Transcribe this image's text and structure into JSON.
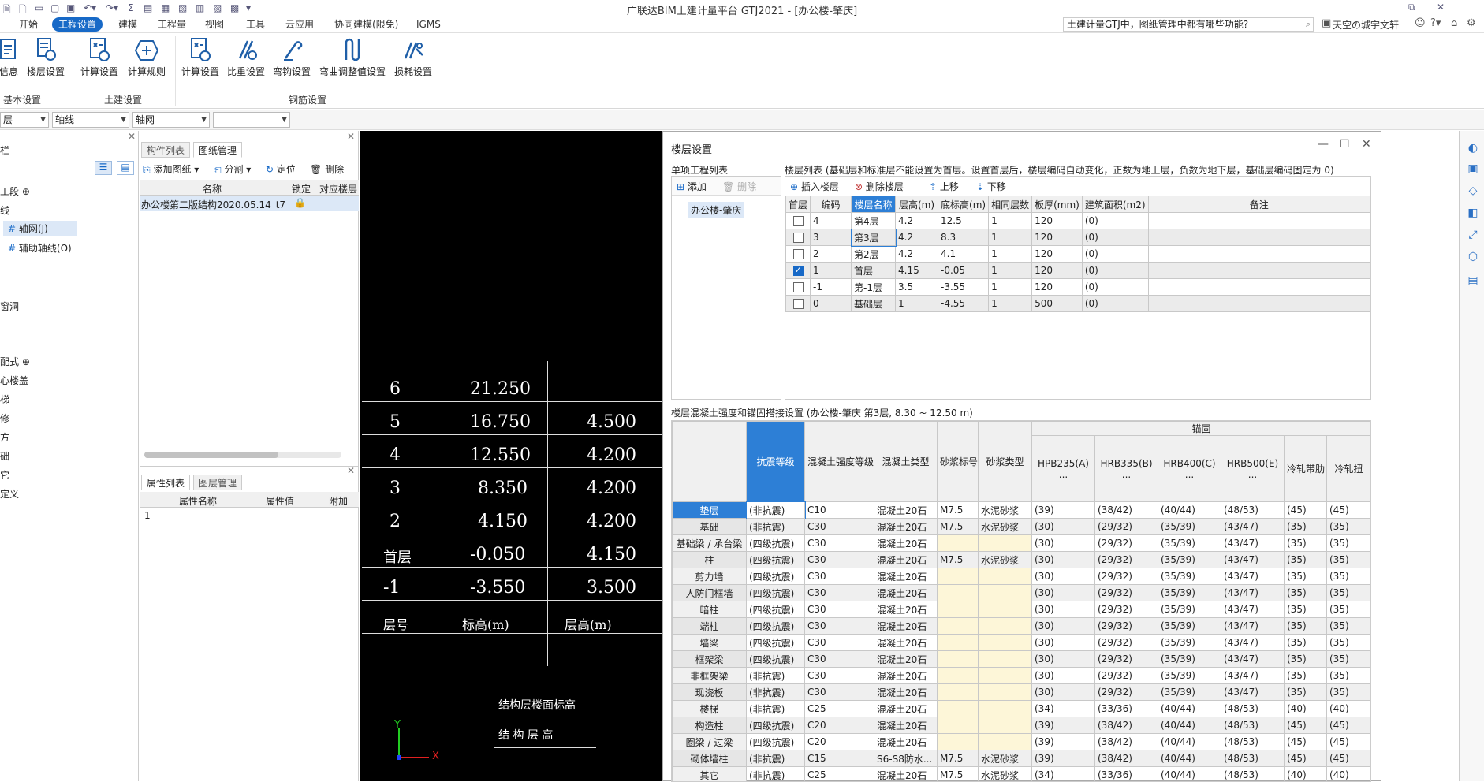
{
  "window": {
    "title": "广联达BIM土建计量平台 GTJ2021 - [办公楼-肇庆]"
  },
  "menu": {
    "items": [
      "开始",
      "工程设置",
      "建模",
      "工程量",
      "视图",
      "工具",
      "云应用",
      "协同建模(限免)",
      "IGMS"
    ],
    "active": "工程设置"
  },
  "search": {
    "value": "土建计量GTJ中，图纸管理中都有哪些功能?"
  },
  "user": {
    "name": "天空の城宇文轩"
  },
  "ribbon": {
    "groups": [
      {
        "label": "基本设置",
        "buttons": [
          "信息",
          "楼层设置"
        ]
      },
      {
        "label": "土建设置",
        "buttons": [
          "计算设置",
          "计算规则"
        ]
      },
      {
        "label": "钢筋设置",
        "buttons": [
          "计算设置",
          "比重设置",
          "弯钩设置",
          "弯曲调整值设置",
          "损耗设置"
        ]
      }
    ]
  },
  "toolbar2": {
    "combo1": "层",
    "combo2": "轴线",
    "combo3": "轴网",
    "combo4": ""
  },
  "left_panel": {
    "header": "栏",
    "items": [
      "工段 ⊕",
      "线",
      "轴网(J)",
      "辅助轴线(O)",
      "窗洞",
      "配式 ⊕",
      "心楼盖",
      "梯",
      "修",
      "方",
      "础",
      "它",
      "定义"
    ]
  },
  "mid_panel": {
    "tabs": [
      "构件列表",
      "图纸管理"
    ],
    "active_tab": "图纸管理",
    "actions": [
      "添加图纸",
      "分割",
      "定位",
      "删除"
    ],
    "columns": [
      "名称",
      "锁定",
      "对应楼层"
    ],
    "rows": [
      {
        "name": "办公楼第二版结构2020.05.14_t7",
        "lock": "🔒",
        "floor": ""
      }
    ],
    "prop_tabs": [
      "属性列表",
      "图层管理"
    ],
    "prop_columns": [
      "属性名称",
      "属性值",
      "附加"
    ],
    "prop_rows": [
      "1"
    ]
  },
  "cad": {
    "rows": [
      {
        "floor": "6",
        "elev": "21.250",
        "height": ""
      },
      {
        "floor": "5",
        "elev": "16.750",
        "height": "4.500"
      },
      {
        "floor": "4",
        "elev": "12.550",
        "height": "4.200"
      },
      {
        "floor": "3",
        "elev": "8.350",
        "height": "4.200"
      },
      {
        "floor": "2",
        "elev": "4.150",
        "height": "4.200"
      },
      {
        "floor": "首层",
        "elev": "-0.050",
        "height": "4.150"
      },
      {
        "floor": "-1",
        "elev": "-3.550",
        "height": "3.500"
      },
      {
        "floor": "层号",
        "elev": "标高(m)",
        "height": "层高(m)"
      }
    ],
    "caption1": "结构层楼面标高",
    "caption2": "结 构 层 高",
    "axis_y": "Y",
    "axis_x": "X"
  },
  "dialog": {
    "title": "楼层设置",
    "project_list_label": "单项工程列表",
    "floor_list_label": "楼层列表 (基础层和标准层不能设置为首层。设置首层后，楼层编码自动变化，正数为地上层，负数为地下层，基础层编码固定为 0)",
    "project_actions": [
      "添加",
      "删除"
    ],
    "project_item": "办公楼-肇庆",
    "floor_actions": [
      "插入楼层",
      "删除楼层",
      "上移",
      "下移"
    ],
    "floor_columns": [
      "首层",
      "编码",
      "楼层名称",
      "层高(m)",
      "底标高(m)",
      "相同层数",
      "板厚(mm)",
      "建筑面积(m2)",
      "备注"
    ],
    "floors": [
      {
        "first": false,
        "code": "4",
        "name": "第4层",
        "height": "4.2",
        "bottom": "12.5",
        "same": "1",
        "slab": "120",
        "area": "(0)",
        "note": ""
      },
      {
        "first": false,
        "code": "3",
        "name": "第3层",
        "height": "4.2",
        "bottom": "8.3",
        "same": "1",
        "slab": "120",
        "area": "(0)",
        "note": ""
      },
      {
        "first": false,
        "code": "2",
        "name": "第2层",
        "height": "4.2",
        "bottom": "4.1",
        "same": "1",
        "slab": "120",
        "area": "(0)",
        "note": ""
      },
      {
        "first": true,
        "code": "1",
        "name": "首层",
        "height": "4.15",
        "bottom": "-0.05",
        "same": "1",
        "slab": "120",
        "area": "(0)",
        "note": ""
      },
      {
        "first": false,
        "code": "-1",
        "name": "第-1层",
        "height": "3.5",
        "bottom": "-3.55",
        "same": "1",
        "slab": "120",
        "area": "(0)",
        "note": ""
      },
      {
        "first": false,
        "code": "0",
        "name": "基础层",
        "height": "1",
        "bottom": "-4.55",
        "same": "1",
        "slab": "500",
        "area": "(0)",
        "note": ""
      }
    ],
    "concrete_label": "楼层混凝土强度和锚固搭接设置 (办公楼-肇庆 第3层, 8.30 ~ 12.50 m)",
    "anchor_header": "锚固",
    "concrete_columns": [
      "抗震等级",
      "混凝土强度等级",
      "混凝土类型",
      "砂浆标号",
      "砂浆类型",
      "HPB235(A)\n...",
      "HRB335(B)\n...",
      "HRB400(C)\n...",
      "HRB500(E)\n...",
      "冷轧带肋",
      "冷轧扭"
    ],
    "concrete_rows": [
      {
        "name": "垫层",
        "seismic": "(非抗震)",
        "grade": "C10",
        "type": "混凝土20石",
        "mortar": "M7.5",
        "mtype": "水泥砂浆",
        "a": "(39)",
        "b": "(38/42)",
        "c": "(40/44)",
        "e": "(48/53)",
        "lz": "(45)",
        "lzn": "(45)"
      },
      {
        "name": "基础",
        "seismic": "(非抗震)",
        "grade": "C30",
        "type": "混凝土20石",
        "mortar": "M7.5",
        "mtype": "水泥砂浆",
        "a": "(30)",
        "b": "(29/32)",
        "c": "(35/39)",
        "e": "(43/47)",
        "lz": "(35)",
        "lzn": "(35)"
      },
      {
        "name": "基础梁 / 承台梁",
        "seismic": "(四级抗震)",
        "grade": "C30",
        "type": "混凝土20石",
        "mortar": "",
        "mtype": "",
        "a": "(30)",
        "b": "(29/32)",
        "c": "(35/39)",
        "e": "(43/47)",
        "lz": "(35)",
        "lzn": "(35)"
      },
      {
        "name": "柱",
        "seismic": "(四级抗震)",
        "grade": "C30",
        "type": "混凝土20石",
        "mortar": "M7.5",
        "mtype": "水泥砂浆",
        "a": "(30)",
        "b": "(29/32)",
        "c": "(35/39)",
        "e": "(43/47)",
        "lz": "(35)",
        "lzn": "(35)"
      },
      {
        "name": "剪力墙",
        "seismic": "(四级抗震)",
        "grade": "C30",
        "type": "混凝土20石",
        "mortar": "",
        "mtype": "",
        "a": "(30)",
        "b": "(29/32)",
        "c": "(35/39)",
        "e": "(43/47)",
        "lz": "(35)",
        "lzn": "(35)"
      },
      {
        "name": "人防门框墙",
        "seismic": "(四级抗震)",
        "grade": "C30",
        "type": "混凝土20石",
        "mortar": "",
        "mtype": "",
        "a": "(30)",
        "b": "(29/32)",
        "c": "(35/39)",
        "e": "(43/47)",
        "lz": "(35)",
        "lzn": "(35)"
      },
      {
        "name": "暗柱",
        "seismic": "(四级抗震)",
        "grade": "C30",
        "type": "混凝土20石",
        "mortar": "",
        "mtype": "",
        "a": "(30)",
        "b": "(29/32)",
        "c": "(35/39)",
        "e": "(43/47)",
        "lz": "(35)",
        "lzn": "(35)"
      },
      {
        "name": "端柱",
        "seismic": "(四级抗震)",
        "grade": "C30",
        "type": "混凝土20石",
        "mortar": "",
        "mtype": "",
        "a": "(30)",
        "b": "(29/32)",
        "c": "(35/39)",
        "e": "(43/47)",
        "lz": "(35)",
        "lzn": "(35)"
      },
      {
        "name": "墙梁",
        "seismic": "(四级抗震)",
        "grade": "C30",
        "type": "混凝土20石",
        "mortar": "",
        "mtype": "",
        "a": "(30)",
        "b": "(29/32)",
        "c": "(35/39)",
        "e": "(43/47)",
        "lz": "(35)",
        "lzn": "(35)"
      },
      {
        "name": "框架梁",
        "seismic": "(四级抗震)",
        "grade": "C30",
        "type": "混凝土20石",
        "mortar": "",
        "mtype": "",
        "a": "(30)",
        "b": "(29/32)",
        "c": "(35/39)",
        "e": "(43/47)",
        "lz": "(35)",
        "lzn": "(35)"
      },
      {
        "name": "非框架梁",
        "seismic": "(非抗震)",
        "grade": "C30",
        "type": "混凝土20石",
        "mortar": "",
        "mtype": "",
        "a": "(30)",
        "b": "(29/32)",
        "c": "(35/39)",
        "e": "(43/47)",
        "lz": "(35)",
        "lzn": "(35)"
      },
      {
        "name": "现浇板",
        "seismic": "(非抗震)",
        "grade": "C30",
        "type": "混凝土20石",
        "mortar": "",
        "mtype": "",
        "a": "(30)",
        "b": "(29/32)",
        "c": "(35/39)",
        "e": "(43/47)",
        "lz": "(35)",
        "lzn": "(35)"
      },
      {
        "name": "楼梯",
        "seismic": "(非抗震)",
        "grade": "C25",
        "type": "混凝土20石",
        "mortar": "",
        "mtype": "",
        "a": "(34)",
        "b": "(33/36)",
        "c": "(40/44)",
        "e": "(48/53)",
        "lz": "(40)",
        "lzn": "(40)"
      },
      {
        "name": "构造柱",
        "seismic": "(四级抗震)",
        "grade": "C20",
        "type": "混凝土20石",
        "mortar": "",
        "mtype": "",
        "a": "(39)",
        "b": "(38/42)",
        "c": "(40/44)",
        "e": "(48/53)",
        "lz": "(45)",
        "lzn": "(45)"
      },
      {
        "name": "圈梁 / 过梁",
        "seismic": "(四级抗震)",
        "grade": "C20",
        "type": "混凝土20石",
        "mortar": "",
        "mtype": "",
        "a": "(39)",
        "b": "(38/42)",
        "c": "(40/44)",
        "e": "(48/53)",
        "lz": "(45)",
        "lzn": "(45)"
      },
      {
        "name": "砌体墙柱",
        "seismic": "(非抗震)",
        "grade": "C15",
        "type": "S6-S8防水...",
        "mortar": "M7.5",
        "mtype": "水泥砂浆",
        "a": "(39)",
        "b": "(38/42)",
        "c": "(40/44)",
        "e": "(48/53)",
        "lz": "(45)",
        "lzn": "(45)"
      },
      {
        "name": "其它",
        "seismic": "(非抗震)",
        "grade": "C25",
        "type": "混凝土20石",
        "mortar": "M7.5",
        "mtype": "水泥砂浆",
        "a": "(34)",
        "b": "(33/36)",
        "c": "(40/44)",
        "e": "(48/53)",
        "lz": "(40)",
        "lzn": "(40)"
      }
    ]
  }
}
